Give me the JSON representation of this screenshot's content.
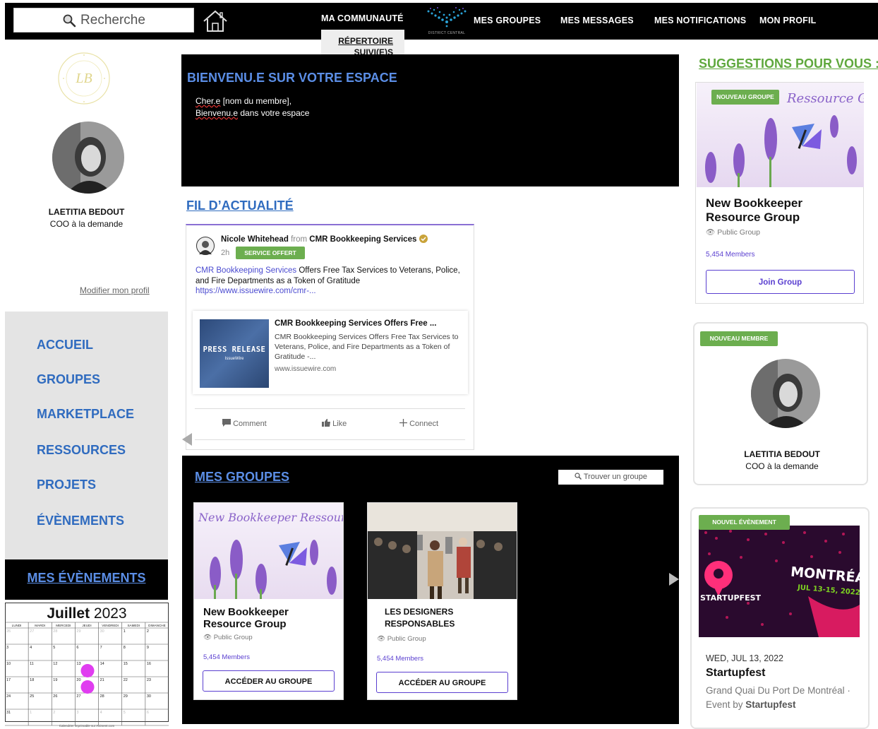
{
  "header": {
    "search_placeholder": "Recherche",
    "nav": {
      "community": "MA COMMUNAUTÉ",
      "groups": "MES GROUPES",
      "messages": "MES MESSAGES",
      "notifications": "MES NOTIFICATIONS",
      "profile": "MON PROFIL"
    },
    "logo_caption": "DISTRICT CENTRAL",
    "dropdown": [
      "RÉPERTOIRE",
      "SUIVI(E)S"
    ]
  },
  "profile": {
    "stamp_monogram": "LB",
    "name": "LAETITIA BEDOUT",
    "role": "COO à la demande",
    "edit_link": "Modifier mon profil"
  },
  "sidebar": {
    "items": [
      "ACCUEIL",
      "GROUPES",
      "MARKETPLACE",
      "RESSOURCES",
      "PROJETS",
      "ÉVÈNEMENTS"
    ]
  },
  "events": {
    "title": "MES ÉVÈNEMENTS",
    "calendar": {
      "month": "Juillet",
      "year": "2023",
      "weekdays": [
        "LUNDI",
        "MARDI",
        "MERCEDI",
        "JEUDI",
        "VENDREDI",
        "SAMEDI",
        "DIMANCHE"
      ],
      "weeks": [
        [
          "26",
          "27",
          "28",
          "29",
          "30",
          "1",
          "2"
        ],
        [
          "3",
          "4",
          "5",
          "6",
          "7",
          "8",
          "9"
        ],
        [
          "10",
          "11",
          "12",
          "13",
          "14",
          "15",
          "16"
        ],
        [
          "17",
          "18",
          "19",
          "20",
          "21",
          "22",
          "23"
        ],
        [
          "24",
          "25",
          "26",
          "27",
          "28",
          "29",
          "30"
        ],
        [
          "31",
          "1",
          "2",
          "3",
          "4",
          "5",
          "6"
        ]
      ],
      "highlighted_days": [
        "13",
        "20"
      ],
      "highlight_color": "#e03df0",
      "footer": "Calendrier imprimable sur Aximent.com"
    }
  },
  "welcome": {
    "title": "BIENVENU.E SUR VOTRE ESPACE",
    "line1_word": "Cher.e",
    "line1_rest": " [nom du membre],",
    "line2_word": "Bienvenu.e",
    "line2_rest": " dans votre espace"
  },
  "feed": {
    "title": "FIL D’ACTUALITÉ",
    "post": {
      "author": "Nicole Whitehead",
      "from": "from",
      "org": "CMR Bookkeeping Services",
      "time": "2h",
      "badge": "SERVICE OFFERT",
      "text_link": "CMR Bookkeeping Services",
      "text_rest": " Offers Free Tax Services to Veterans, Police, and Fire Departments as a Token of Gratitude",
      "url": "https://www.issuewire.com/cmr-...",
      "card": {
        "image_text": "PRESS RELEASE",
        "image_sub": "IssueWire",
        "title": "CMR Bookkeeping Services Offers Free ...",
        "desc": "CMR Bookkeeping Services Offers Free Tax Services to Veterans, Police, and Fire Departments as a Token of Gratitude -...",
        "domain": "www.issuewire.com"
      },
      "actions": [
        "Comment",
        "Like",
        "Connect"
      ]
    }
  },
  "my_groups": {
    "title": "MES GROUPES",
    "find_button": "Trouver un groupe",
    "cards": [
      {
        "image_text": "New Bookkeeper Ressource Group",
        "name_line1": "New Bookkeeper",
        "name_line2": "Resource Group",
        "visibility": "Public Group",
        "members": "5,454 Members",
        "button": "ACCÉDER AU GROUPE"
      },
      {
        "name_line1": "LES DESIGNERS",
        "name_line2": "RESPONSABLES",
        "visibility": "Public Group",
        "members": "5,454 Members",
        "button": "ACCÉDER AU GROUPE"
      }
    ]
  },
  "suggestions": {
    "title": "SUGGESTIONS POUR VOUS :",
    "group": {
      "badge": "NOUVEAU GROUPE",
      "image_text": "Ressource Group",
      "name_line1": "New Bookkeeper",
      "name_line2": "Resource Group",
      "visibility": "Public Group",
      "members": "5,454 Members",
      "button": "Join Group"
    },
    "member": {
      "badge": "NOUVEAU MEMBRE",
      "name": "LAETITIA BEDOUT",
      "role": "COO à la demande"
    },
    "event": {
      "badge": "NOUVEL ÉVÈNEMENT",
      "image_city": "MONTRÉAL",
      "image_dates": "JUL 13-15, 2022",
      "image_brand": "STARTUPFEST",
      "date": "WED, JUL 13, 2022",
      "name": "Startupfest",
      "location": "Grand Quai Du Port De Montréal ·",
      "by_prefix": "Event by ",
      "by_name": "Startupfest"
    }
  },
  "colors": {
    "accent_blue": "#2f6bbf",
    "accent_green": "#6cae4f",
    "accent_purple": "#5a3fd0"
  }
}
